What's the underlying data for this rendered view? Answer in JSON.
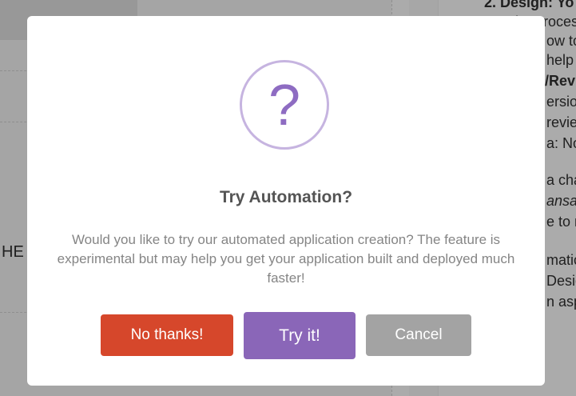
{
  "background": {
    "left_text": "HE",
    "right_fragments": [
      "2. Design: Yo",
      "the process",
      "ow to",
      "help",
      "/Rev",
      "ersion",
      "revie",
      "a: Nov",
      "a cha",
      "ansac",
      "e to m",
      "matic",
      "Desig",
      "n asp"
    ]
  },
  "dialog": {
    "icon": "question-mark",
    "icon_glyph": "?",
    "title": "Try Automation?",
    "message": "Would you like to try our automated application creation? The feature is experimental but may help you get your application built and deployed much faster!",
    "buttons": {
      "decline": "No thanks!",
      "accept": "Try it!",
      "cancel": "Cancel"
    }
  },
  "colors": {
    "decline": "#d6472b",
    "accept": "#8a66b8",
    "cancel": "#a3a3a3",
    "icon": "#8e6cc2"
  }
}
